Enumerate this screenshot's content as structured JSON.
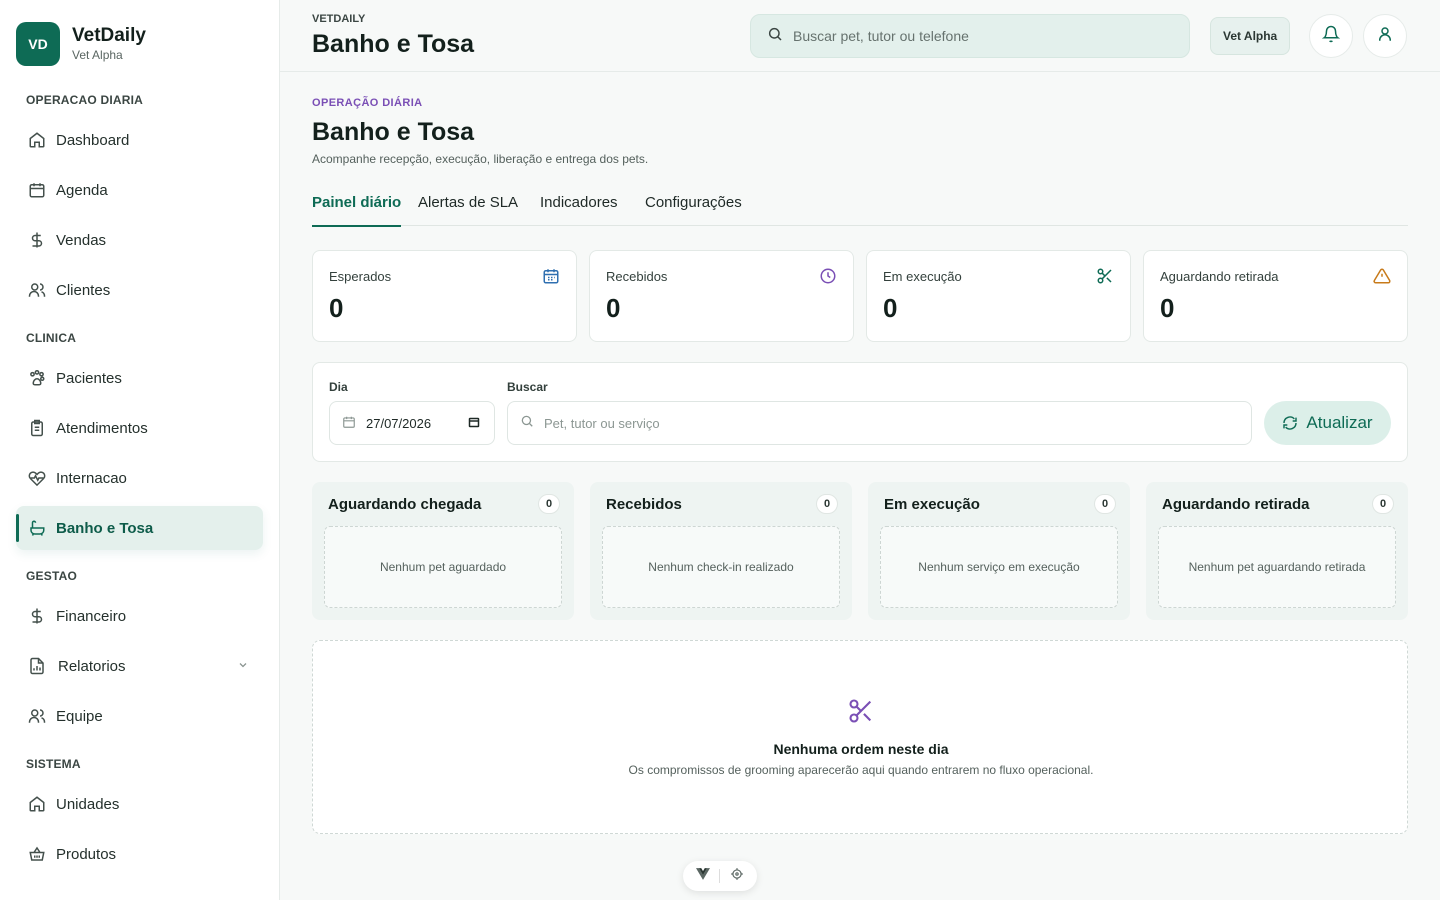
{
  "brand": {
    "logo": "VD",
    "name": "VetDaily",
    "subtitle": "Vet Alpha"
  },
  "sidebar": {
    "sections": [
      {
        "label": "OPERACAO DIARIA"
      },
      {
        "label": "CLINICA"
      },
      {
        "label": "GESTAO"
      },
      {
        "label": "SISTEMA"
      }
    ],
    "items": [
      {
        "label": "Dashboard",
        "icon": "home-icon"
      },
      {
        "label": "Agenda",
        "icon": "calendar-icon"
      },
      {
        "label": "Vendas",
        "icon": "dollar-icon"
      },
      {
        "label": "Clientes",
        "icon": "users-icon"
      },
      {
        "label": "Pacientes",
        "icon": "paw-icon"
      },
      {
        "label": "Atendimentos",
        "icon": "clipboard-icon"
      },
      {
        "label": "Internacao",
        "icon": "heart-pulse-icon"
      },
      {
        "label": "Banho e Tosa",
        "icon": "bath-icon",
        "active": true
      },
      {
        "label": "Financeiro",
        "icon": "dollar-icon"
      },
      {
        "label": "Relatorios",
        "icon": "report-icon"
      },
      {
        "label": "Equipe",
        "icon": "users-icon"
      },
      {
        "label": "Unidades",
        "icon": "home-icon"
      },
      {
        "label": "Produtos",
        "icon": "basket-icon"
      }
    ]
  },
  "topbar": {
    "eyebrow": "VETDAILY",
    "title": "Banho e Tosa",
    "search_placeholder": "Buscar pet, tutor ou telefone",
    "unit_badge": "Vet Alpha"
  },
  "page": {
    "eyebrow": "OPERAÇÃO DIÁRIA",
    "title": "Banho e Tosa",
    "description": "Acompanhe recepção, execução, liberação e entrega dos pets."
  },
  "tabs": [
    {
      "label": "Painel diário",
      "active": true
    },
    {
      "label": "Alertas de SLA"
    },
    {
      "label": "Indicadores"
    },
    {
      "label": "Configurações"
    }
  ],
  "kpis": [
    {
      "label": "Esperados",
      "value": "0",
      "icon": "calendar-icon",
      "color": "#2f6fb0"
    },
    {
      "label": "Recebidos",
      "value": "0",
      "icon": "clock-icon",
      "color": "#7a4fb5"
    },
    {
      "label": "Em execução",
      "value": "0",
      "icon": "scissors-icon",
      "color": "#0e6b55"
    },
    {
      "label": "Aguardando retirada",
      "value": "0",
      "icon": "warning-icon",
      "color": "#c77a1a"
    }
  ],
  "filters": {
    "day_label": "Dia",
    "day_value": "27/07/2026",
    "search_label": "Buscar",
    "search_placeholder": "Pet, tutor ou serviço",
    "refresh_label": "Atualizar"
  },
  "columns": [
    {
      "title": "Aguardando chegada",
      "count": "0",
      "empty": "Nenhum pet aguardado"
    },
    {
      "title": "Recebidos",
      "count": "0",
      "empty": "Nenhum check-in realizado"
    },
    {
      "title": "Em execução",
      "count": "0",
      "empty": "Nenhum serviço em execução"
    },
    {
      "title": "Aguardando retirada",
      "count": "0",
      "empty": "Nenhum pet aguardando retirada"
    }
  ],
  "empty_state": {
    "title": "Nenhuma ordem neste dia",
    "description": "Os compromissos de grooming aparecerão aqui quando entrarem no fluxo operacional."
  },
  "colors": {
    "primary": "#0e6b55",
    "accent_purple": "#7a4fb5"
  }
}
